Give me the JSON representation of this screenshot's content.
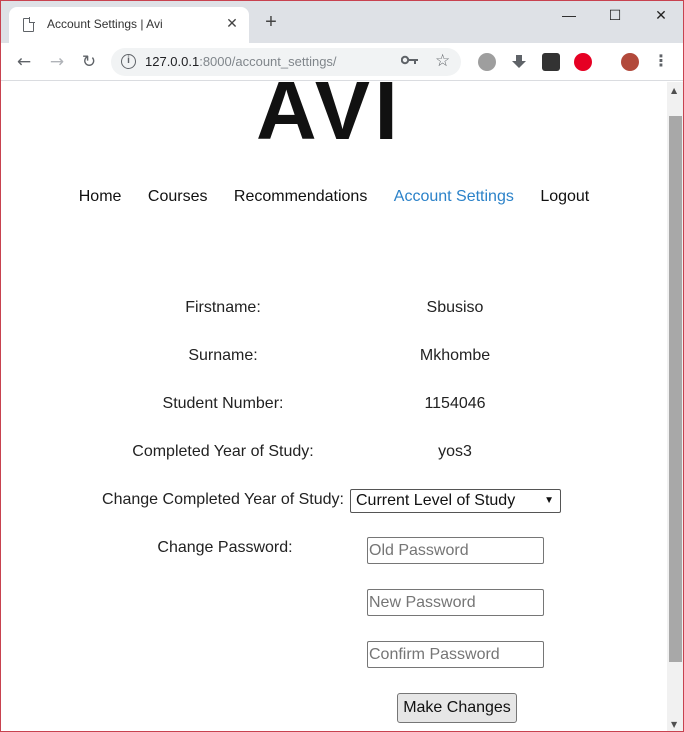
{
  "browser": {
    "tab_title": "Account Settings | Avi",
    "tab_close": "✕",
    "new_tab": "+",
    "url_host": "127.0.0.1",
    "url_rest": ":8000/account_settings/",
    "window_controls": [
      "—",
      "☐",
      "✕"
    ],
    "icons": [
      "back-arrow-icon",
      "forward-arrow-icon",
      "reload-icon",
      "info-icon",
      "key-icon",
      "star-icon",
      "extension-icon",
      "download-icon",
      "extension-icon",
      "pinterest-icon",
      "profile-icon",
      "menu-icon"
    ]
  },
  "site": {
    "logo": "AVI",
    "nav": [
      {
        "label": "Home",
        "active": false
      },
      {
        "label": "Courses",
        "active": false
      },
      {
        "label": "Recommendations",
        "active": false
      },
      {
        "label": "Account Settings",
        "active": true
      },
      {
        "label": "Logout",
        "active": false
      }
    ],
    "accent_color": "#2b82c9"
  },
  "account": {
    "firstname_label": "Firstname:",
    "firstname_value": "Sbusiso",
    "surname_label": "Surname:",
    "surname_value": "Mkhombe",
    "student_number_label": "Student Number:",
    "student_number_value": "1154046",
    "completed_year_label": "Completed Year of Study:",
    "completed_year_value": "yos3",
    "change_year_label": "Change Completed Year of Study:",
    "change_year_selected": "Current Level of Study",
    "change_password_label": "Change Password:",
    "old_password_placeholder": "Old Password",
    "new_password_placeholder": "New Password",
    "confirm_password_placeholder": "Confirm Password",
    "submit_label": "Make Changes"
  }
}
